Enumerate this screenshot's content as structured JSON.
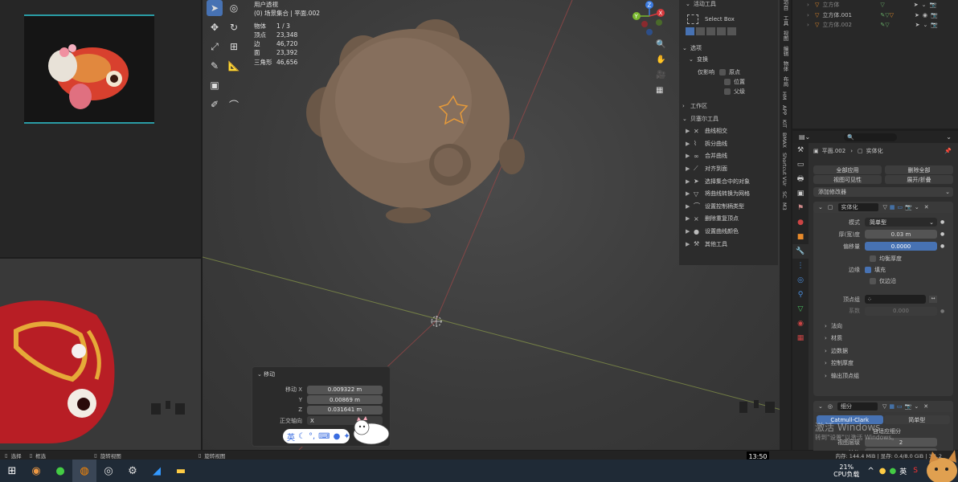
{
  "viewport": {
    "title": "用户透视",
    "subtitle": "(0) 场景集合 | 平面.002",
    "stats": [
      {
        "k": "物体",
        "v": "1 / 3"
      },
      {
        "k": "顶点",
        "v": "23,348"
      },
      {
        "k": "边",
        "v": "46,720"
      },
      {
        "k": "面",
        "v": "23,392"
      },
      {
        "k": "三角形",
        "v": "46,656"
      }
    ],
    "gizmo": {
      "x": "X",
      "y": "Y",
      "z": "Z"
    }
  },
  "move_panel": {
    "title": "移动",
    "rows": [
      {
        "label": "移动 X",
        "value": "0.009322 m"
      },
      {
        "label": "Y",
        "value": "0.00869 m"
      },
      {
        "label": "Z",
        "value": "0.031641 m"
      }
    ],
    "orient_label": "正交轴向",
    "orient_value": "X"
  },
  "ime": {
    "lang": "英"
  },
  "sidebar": {
    "active_tool_header": "活动工具",
    "select_box": "Select Box",
    "options": "选项",
    "transform": "变换",
    "affect_only": "仅影响",
    "origins": "原点",
    "locations": "位置",
    "parents": "父级",
    "workspace": "工作区",
    "bezier_tools": "贝塞尔工具",
    "items": [
      "曲线相交",
      "拆分曲线",
      "合并曲线",
      "对齐到面",
      "选择集合中的对象",
      "将曲线转换为网格",
      "设置控制柄类型",
      "删除重复顶点",
      "设置曲线颜色",
      "其他工具"
    ]
  },
  "vtabs": [
    "项目",
    "工具",
    "视图",
    "编辑",
    "物体",
    "布局",
    "HM",
    "APP",
    "KIT",
    "BMAX",
    "Shortcut VUr",
    "SC",
    "M3"
  ],
  "outliner": {
    "rows": [
      {
        "name": "立方体"
      },
      {
        "name": "立方体.001"
      },
      {
        "name": "立方体.002"
      }
    ]
  },
  "properties": {
    "search_placeholder": "",
    "breadcrumb_obj": "平面.002",
    "breadcrumb_mod": "实体化",
    "apply_all": "全部应用",
    "delete_all": "删除全部",
    "viewport_vis": "视图可见性",
    "expand_collapse": "展开/折叠",
    "add_modifier": "添加修改器",
    "solidify": {
      "name": "实体化",
      "mode_label": "模式",
      "mode_value": "简单型",
      "thickness_label": "厚(宽)度",
      "thickness_value": "0.03 m",
      "offset_label": "偏移量",
      "offset_value": "0.0000",
      "even_thickness": "均衡厚度",
      "rim_label": "边缘",
      "fill": "填充",
      "only_rim": "仅边沿",
      "vgroup_label": "顶点组",
      "factor_label": "系数",
      "factor_value": "0.000",
      "sections": [
        "法向",
        "材质",
        "边数据",
        "控制厚度",
        "输出顶点组"
      ]
    },
    "subsurf": {
      "name": "细分",
      "catmull": "Catmull-Clark",
      "simple": "简单型",
      "adaptive": "自适应细分",
      "viewport_label": "视图层级",
      "viewport_value": "2",
      "render_label": "渲染",
      "render_value": "2"
    },
    "watermark1": "激活 Windows",
    "watermark2": "转到\"设置\"以激活 Windows。"
  },
  "statusbar": {
    "select": "选择",
    "box_select": "框选",
    "rotate_view": "旋转视图",
    "rotate_view2": "旋转视图",
    "memory": "内存: 144.4 MiB | 显存: 0.4/8.0 GiB | 3.1.2"
  },
  "taskbar": {
    "time": "13:50",
    "cpu_pct": "21%",
    "cpu_label": "CPU负载",
    "lang": "英",
    "right_extra": "S"
  }
}
